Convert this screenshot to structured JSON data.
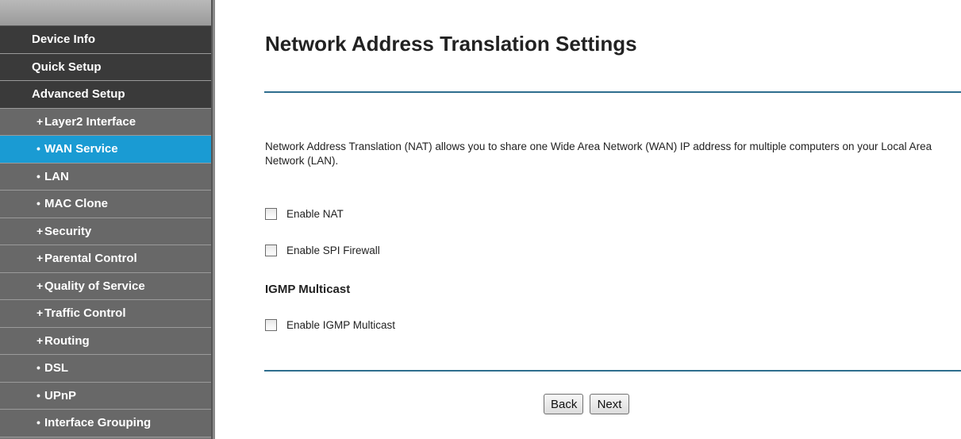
{
  "sidebar": {
    "items": [
      {
        "label": "Device Info",
        "bullet": "",
        "level": "top",
        "active": false
      },
      {
        "label": "Quick Setup",
        "bullet": "",
        "level": "top",
        "active": false
      },
      {
        "label": "Advanced Setup",
        "bullet": "",
        "level": "top",
        "active": false
      },
      {
        "label": "Layer2 Interface",
        "bullet": "+",
        "level": "sub",
        "active": false
      },
      {
        "label": "WAN Service",
        "bullet": "•",
        "level": "sub",
        "active": true
      },
      {
        "label": "LAN",
        "bullet": "•",
        "level": "sub",
        "active": false
      },
      {
        "label": "MAC Clone",
        "bullet": "•",
        "level": "sub",
        "active": false
      },
      {
        "label": "Security",
        "bullet": "+",
        "level": "sub",
        "active": false
      },
      {
        "label": "Parental Control",
        "bullet": "+",
        "level": "sub",
        "active": false
      },
      {
        "label": "Quality of Service",
        "bullet": "+",
        "level": "sub",
        "active": false
      },
      {
        "label": "Traffic Control",
        "bullet": "+",
        "level": "sub",
        "active": false
      },
      {
        "label": "Routing",
        "bullet": "+",
        "level": "sub",
        "active": false
      },
      {
        "label": "DSL",
        "bullet": "•",
        "level": "sub",
        "active": false
      },
      {
        "label": "UPnP",
        "bullet": "•",
        "level": "sub",
        "active": false
      },
      {
        "label": "Interface Grouping",
        "bullet": "•",
        "level": "sub",
        "active": false
      }
    ]
  },
  "main": {
    "title": "Network Address Translation Settings",
    "description": "Network Address Translation (NAT) allows you to share one Wide Area Network (WAN) IP address for multiple computers on your Local Area Network (LAN).",
    "options": {
      "enable_nat": {
        "label": "Enable NAT",
        "checked": false
      },
      "enable_spi": {
        "label": "Enable SPI Firewall",
        "checked": false
      },
      "enable_igmp": {
        "label": "Enable IGMP Multicast",
        "checked": false
      }
    },
    "igmp_heading": "IGMP Multicast",
    "buttons": {
      "back": "Back",
      "next": "Next"
    }
  },
  "colors": {
    "active_item": "#1a9bd3",
    "top_item": "#3a3a3a",
    "sub_item": "#686868",
    "rule": "#2e6e8e"
  }
}
